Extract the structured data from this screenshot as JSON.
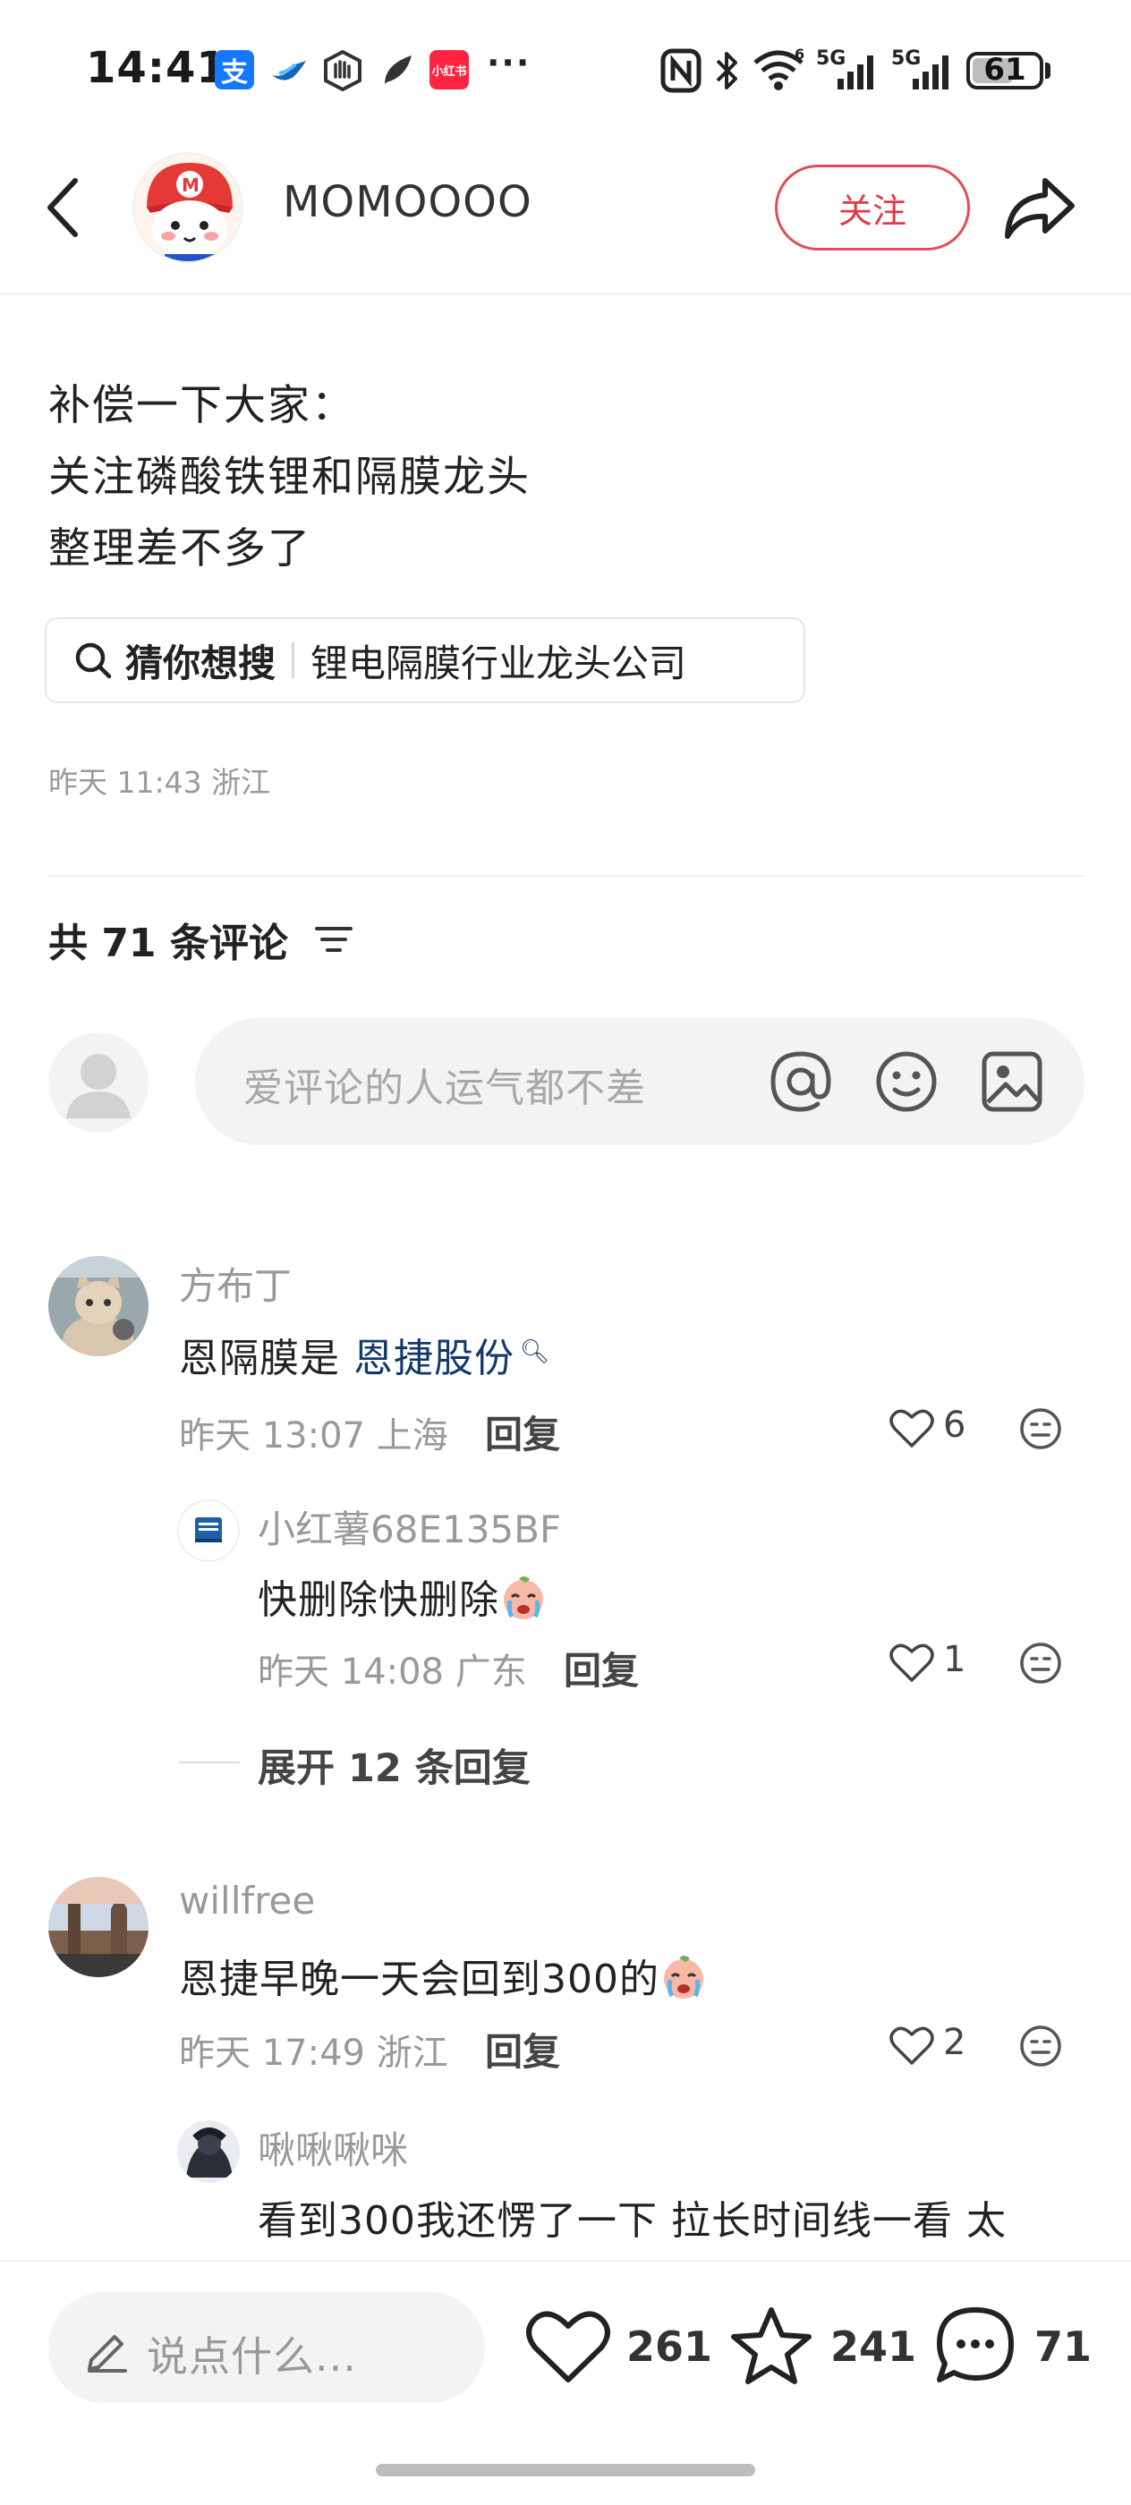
{
  "status_bar": {
    "time": "14:41",
    "app_icons": [
      {
        "name": "alipay-icon",
        "label": "支",
        "color": "#1677ff"
      },
      {
        "name": "bird-app-icon",
        "color": "#1565c0"
      },
      {
        "name": "hand-app-icon",
        "color": "#333333"
      },
      {
        "name": "feather-app-icon",
        "color": "#333333"
      },
      {
        "name": "xiaohongshu-app-icon",
        "label": "小红书",
        "color": "#ff2442"
      }
    ],
    "more_indicator": "···",
    "signal": [
      "5G",
      "5G"
    ],
    "battery": "61",
    "battery_level_percent": 61
  },
  "header": {
    "author_name": "MOMOOOO",
    "follow_label": "关注"
  },
  "post": {
    "lines": [
      "补偿一下大家：",
      "关注磷酸铁锂和隔膜龙头",
      "整理差不多了"
    ],
    "search_chip": {
      "label": "猜你想搜",
      "query": "锂电隔膜行业龙头公司"
    },
    "meta": "昨天 11:43 浙江"
  },
  "comments_section": {
    "count_label": "共 71 条评论",
    "input_placeholder": "爱评论的人运气都不差"
  },
  "comments": [
    {
      "user": "方布丁",
      "text_prefix": "恩隔膜是",
      "text_link": "恩捷股份",
      "time": "昨天 13:07 上海",
      "reply_label": "回复",
      "likes": "6",
      "replies": [
        {
          "user": "小红薯68E135BF",
          "text": "快删除快删除",
          "time": "昨天 14:08 广东",
          "reply_label": "回复",
          "likes": "1"
        }
      ],
      "expand_label": "展开 12 条回复"
    },
    {
      "user": "willfree",
      "text": "恩捷早晚一天会回到300的",
      "time": "昨天 17:49 浙江",
      "reply_label": "回复",
      "likes": "2",
      "replies": [
        {
          "user": "啾啾啾咪",
          "text": "看到300我还愣了一下 拉长时间线一看 太"
        }
      ]
    }
  ],
  "bottom_bar": {
    "say_placeholder": "说点什么...",
    "likes": "261",
    "favorites": "241",
    "comments": "71"
  },
  "colors": {
    "accent_red": "#e13a49",
    "link_blue": "#13386c",
    "muted_gray": "#999999"
  }
}
